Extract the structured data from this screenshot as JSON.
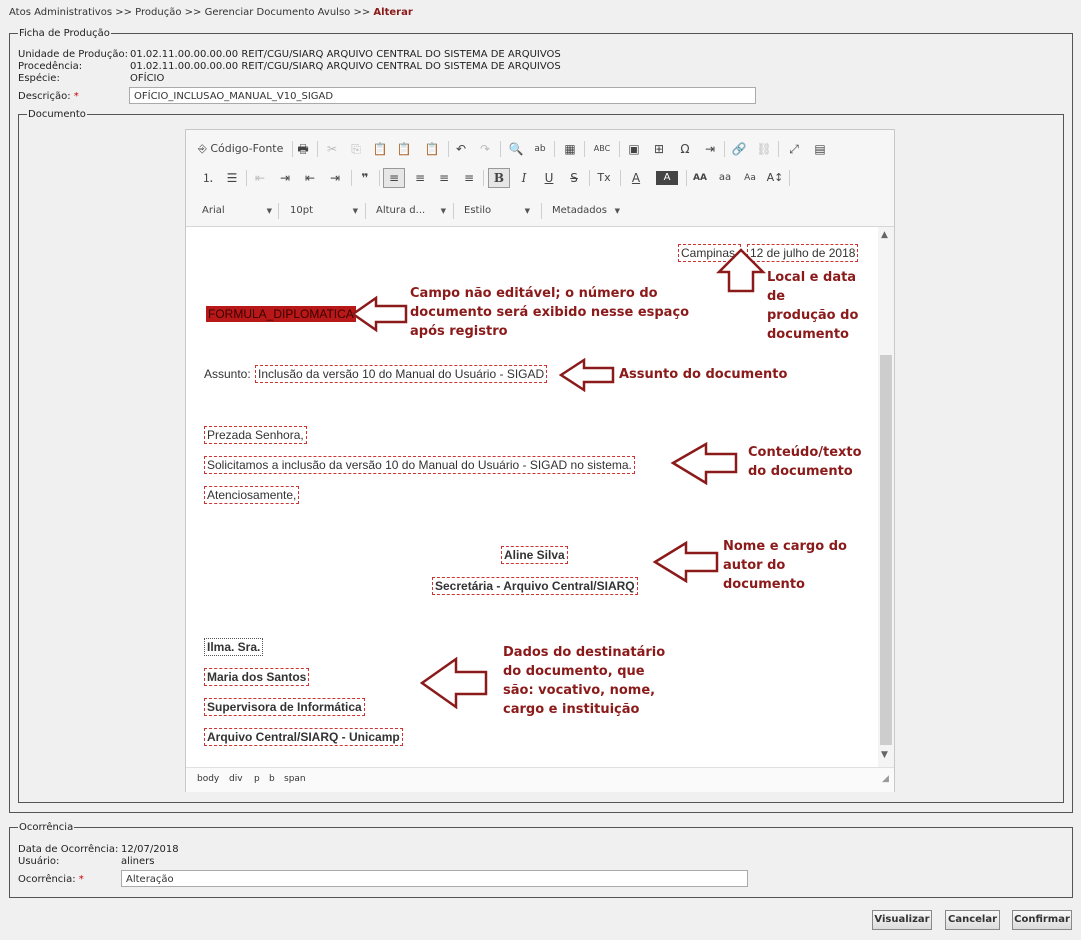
{
  "breadcrumb": {
    "path": "Atos Administrativos >> Produção >> Gerenciar Documento Avulso >>",
    "current": "Alterar"
  },
  "ficha": {
    "legend": "Ficha de Produção",
    "unidade_label": "Unidade de Produção:",
    "unidade_value": "01.02.11.00.00.00.00 REIT/CGU/SIARQ ARQUIVO CENTRAL DO SISTEMA DE ARQUIVOS",
    "procedencia_label": "Procedência:",
    "procedencia_value": "01.02.11.00.00.00.00 REIT/CGU/SIARQ ARQUIVO CENTRAL DO SISTEMA DE ARQUIVOS",
    "especie_label": "Espécie:",
    "especie_value": "OFÍCIO",
    "descricao_label": "Descrição:",
    "required_mark": "*",
    "descricao_value": "OFÍCIO_INCLUSAO_MANUAL_V10_SIGAD"
  },
  "documento": {
    "legend": "Documento"
  },
  "toolbar": {
    "source_label": "Código-Fonte",
    "font_family": "Arial",
    "font_size": "10pt",
    "line_height": "Altura d...",
    "style": "Estilo",
    "metadata": "Metadados",
    "icons": {
      "source": "⎆",
      "print": "🖶",
      "cut": "✂",
      "copy": "⎘",
      "paste": "📋",
      "paste_text": "📋",
      "paste_word": "📋",
      "undo": "↶",
      "redo": "↷",
      "find": "🔍",
      "replace": "ab",
      "select_all": "▦",
      "spell": "ABC",
      "image": "▣",
      "table": "⊞",
      "omega": "Ω",
      "indent_special": "⇥",
      "link": "🔗",
      "unlink": "⛓",
      "maximize": "⤢",
      "blocks": "▤",
      "numbered_list": "⒈",
      "bullet_list": "☰",
      "outdent_dim": "⇤",
      "indent_dim": "⇥",
      "outdent": "⇤",
      "indent": "⇥",
      "quote": "❞",
      "align_left": "≡",
      "align_center": "≡",
      "align_right": "≡",
      "justify": "≡",
      "bold": "B",
      "italic": "I",
      "underline": "U",
      "strike": "S",
      "remove_format": "Tx",
      "text_color": "A",
      "bg_color": "A",
      "upper": "AA",
      "lower": "aa",
      "capitalize": "Aa",
      "transform": "A↕"
    }
  },
  "doc": {
    "city": "Campinas,",
    "date": "12 de julho de 2018",
    "formula": "FORMULA_DIPLOMATICA",
    "subject_label": "Assunto:",
    "subject_value": "Inclusão da versão 10 do Manual do Usuário - SIGAD",
    "greeting": "Prezada Senhora,",
    "body": "Solicitamos a inclusão da versão 10 do Manual do Usuário - SIGAD no sistema.",
    "closing": "Atenciosamente,",
    "author_name": "Aline Silva",
    "author_role": "Secretária - Arquivo Central/SIARQ",
    "vocative": "Ilma. Sra.",
    "recipient_name": "Maria dos Santos",
    "recipient_role": "Supervisora de Informática",
    "recipient_institution": "Arquivo Central/SIARQ - Unicamp"
  },
  "annotations": {
    "local_data": [
      "Local e data de",
      "produção do",
      "documento"
    ],
    "campo": [
      "Campo não editável; o número do",
      "documento será exibido nesse espaço",
      "após registro"
    ],
    "assunto": [
      "Assunto do documento"
    ],
    "conteudo": [
      "Conteúdo/texto",
      "do documento"
    ],
    "autor": [
      "Nome e cargo do",
      "autor do",
      "documento"
    ],
    "destinatario": [
      "Dados do destinatário",
      "do documento, que",
      "são: vocativo, nome,",
      "cargo e instituição"
    ]
  },
  "statusbar": {
    "path": [
      "body",
      "div",
      "p",
      "b",
      "span"
    ]
  },
  "ocorrencia": {
    "legend": "Ocorrência",
    "data_label": "Data de Ocorrência:",
    "data_value": "12/07/2018",
    "usuario_label": "Usuário:",
    "usuario_value": "aliners",
    "ocorrencia_label": "Ocorrência:",
    "ocorrencia_value": "Alteração"
  },
  "buttons": {
    "visualizar": "Visualizar",
    "cancelar": "Cancelar",
    "confirmar": "Confirmar"
  },
  "colors": {
    "accent": "#8b1a1a",
    "formula_bg": "#b91818",
    "dashed_border": "#cc3333"
  }
}
